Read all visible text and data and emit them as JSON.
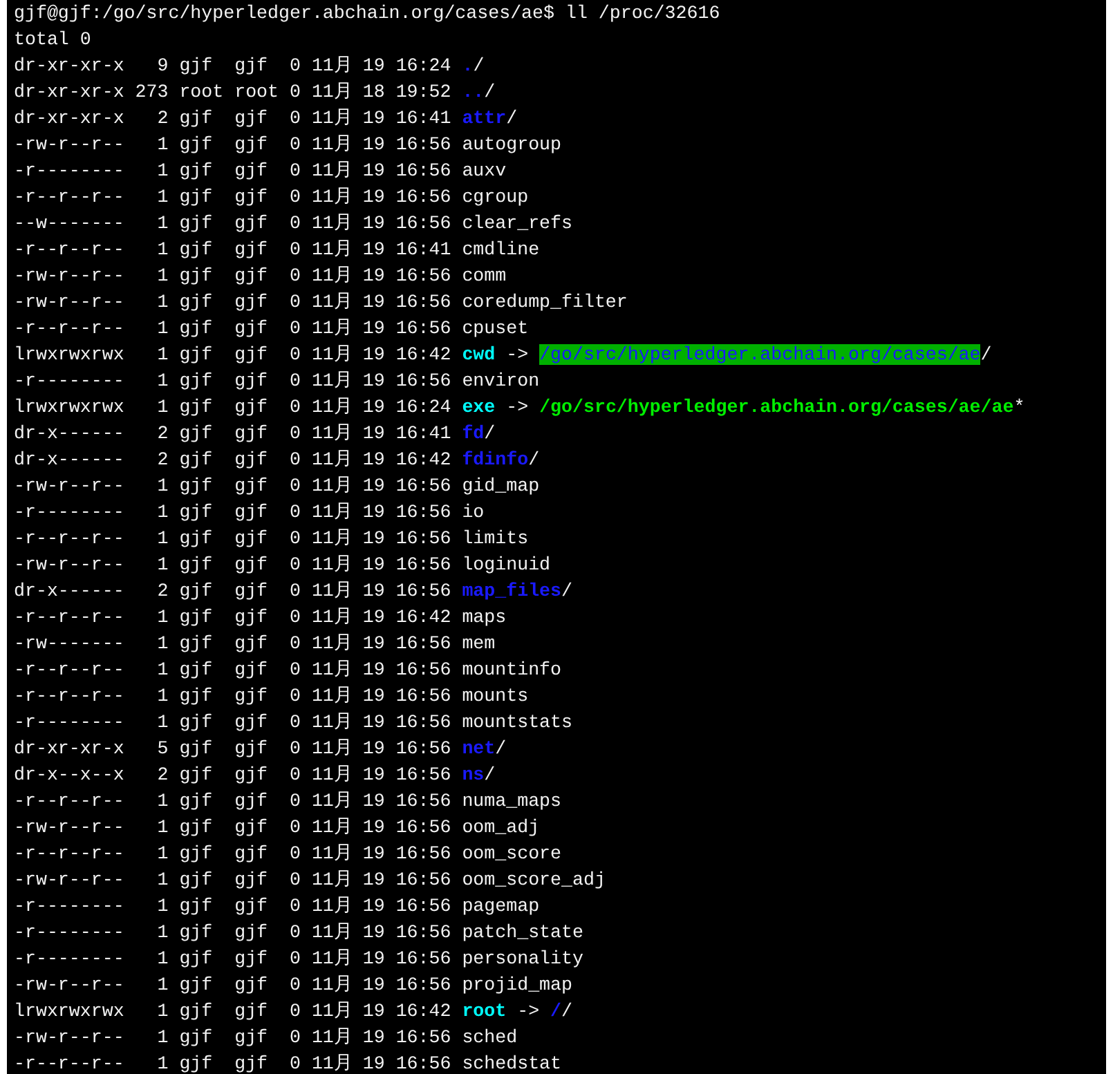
{
  "lines": [
    {
      "segments": [
        {
          "kind": "text",
          "text": "gjf@gjf:/go/src/hyperledger.abchain.org/cases/ae$ ll /proc/32616"
        }
      ]
    },
    {
      "segments": [
        {
          "kind": "text",
          "text": "total 0"
        }
      ]
    },
    {
      "segments": [
        {
          "kind": "text",
          "text": "dr-xr-xr-x   9 gjf  gjf  0 11月 19 16:24 "
        },
        {
          "kind": "dir",
          "text": "."
        },
        {
          "kind": "text",
          "text": "/"
        }
      ]
    },
    {
      "segments": [
        {
          "kind": "text",
          "text": "dr-xr-xr-x 273 root root 0 11月 18 19:52 "
        },
        {
          "kind": "dir",
          "text": ".."
        },
        {
          "kind": "text",
          "text": "/"
        }
      ]
    },
    {
      "segments": [
        {
          "kind": "text",
          "text": "dr-xr-xr-x   2 gjf  gjf  0 11月 19 16:41 "
        },
        {
          "kind": "dir",
          "text": "attr"
        },
        {
          "kind": "text",
          "text": "/"
        }
      ]
    },
    {
      "segments": [
        {
          "kind": "text",
          "text": "-rw-r--r--   1 gjf  gjf  0 11月 19 16:56 autogroup"
        }
      ]
    },
    {
      "segments": [
        {
          "kind": "text",
          "text": "-r--------   1 gjf  gjf  0 11月 19 16:56 auxv"
        }
      ]
    },
    {
      "segments": [
        {
          "kind": "text",
          "text": "-r--r--r--   1 gjf  gjf  0 11月 19 16:56 cgroup"
        }
      ]
    },
    {
      "segments": [
        {
          "kind": "text",
          "text": "--w-------   1 gjf  gjf  0 11月 19 16:56 clear_refs"
        }
      ]
    },
    {
      "segments": [
        {
          "kind": "text",
          "text": "-r--r--r--   1 gjf  gjf  0 11月 19 16:41 cmdline"
        }
      ]
    },
    {
      "segments": [
        {
          "kind": "text",
          "text": "-rw-r--r--   1 gjf  gjf  0 11月 19 16:56 comm"
        }
      ]
    },
    {
      "segments": [
        {
          "kind": "text",
          "text": "-rw-r--r--   1 gjf  gjf  0 11月 19 16:56 coredump_filter"
        }
      ]
    },
    {
      "segments": [
        {
          "kind": "text",
          "text": "-r--r--r--   1 gjf  gjf  0 11月 19 16:56 cpuset"
        }
      ]
    },
    {
      "segments": [
        {
          "kind": "text",
          "text": "lrwxrwxrwx   1 gjf  gjf  0 11月 19 16:42 "
        },
        {
          "kind": "link",
          "text": "cwd"
        },
        {
          "kind": "text",
          "text": " -> "
        },
        {
          "kind": "sticky",
          "text": "/go/src/hyperledger.abchain.org/cases/ae"
        },
        {
          "kind": "text",
          "text": "/"
        }
      ]
    },
    {
      "segments": [
        {
          "kind": "text",
          "text": "-r--------   1 gjf  gjf  0 11月 19 16:56 environ"
        }
      ]
    },
    {
      "segments": [
        {
          "kind": "text",
          "text": "lrwxrwxrwx   1 gjf  gjf  0 11月 19 16:24 "
        },
        {
          "kind": "link",
          "text": "exe"
        },
        {
          "kind": "text",
          "text": " -> "
        },
        {
          "kind": "exec",
          "text": "/go/src/hyperledger.abchain.org/cases/ae/ae"
        },
        {
          "kind": "text",
          "text": "*"
        }
      ]
    },
    {
      "segments": [
        {
          "kind": "text",
          "text": "dr-x------   2 gjf  gjf  0 11月 19 16:41 "
        },
        {
          "kind": "dir",
          "text": "fd"
        },
        {
          "kind": "text",
          "text": "/"
        }
      ]
    },
    {
      "segments": [
        {
          "kind": "text",
          "text": "dr-x------   2 gjf  gjf  0 11月 19 16:42 "
        },
        {
          "kind": "dir",
          "text": "fdinfo"
        },
        {
          "kind": "text",
          "text": "/"
        }
      ]
    },
    {
      "segments": [
        {
          "kind": "text",
          "text": "-rw-r--r--   1 gjf  gjf  0 11月 19 16:56 gid_map"
        }
      ]
    },
    {
      "segments": [
        {
          "kind": "text",
          "text": "-r--------   1 gjf  gjf  0 11月 19 16:56 io"
        }
      ]
    },
    {
      "segments": [
        {
          "kind": "text",
          "text": "-r--r--r--   1 gjf  gjf  0 11月 19 16:56 limits"
        }
      ]
    },
    {
      "segments": [
        {
          "kind": "text",
          "text": "-rw-r--r--   1 gjf  gjf  0 11月 19 16:56 loginuid"
        }
      ]
    },
    {
      "segments": [
        {
          "kind": "text",
          "text": "dr-x------   2 gjf  gjf  0 11月 19 16:56 "
        },
        {
          "kind": "dir",
          "text": "map_files"
        },
        {
          "kind": "text",
          "text": "/"
        }
      ]
    },
    {
      "segments": [
        {
          "kind": "text",
          "text": "-r--r--r--   1 gjf  gjf  0 11月 19 16:42 maps"
        }
      ]
    },
    {
      "segments": [
        {
          "kind": "text",
          "text": "-rw-------   1 gjf  gjf  0 11月 19 16:56 mem"
        }
      ]
    },
    {
      "segments": [
        {
          "kind": "text",
          "text": "-r--r--r--   1 gjf  gjf  0 11月 19 16:56 mountinfo"
        }
      ]
    },
    {
      "segments": [
        {
          "kind": "text",
          "text": "-r--r--r--   1 gjf  gjf  0 11月 19 16:56 mounts"
        }
      ]
    },
    {
      "segments": [
        {
          "kind": "text",
          "text": "-r--------   1 gjf  gjf  0 11月 19 16:56 mountstats"
        }
      ]
    },
    {
      "segments": [
        {
          "kind": "text",
          "text": "dr-xr-xr-x   5 gjf  gjf  0 11月 19 16:56 "
        },
        {
          "kind": "dir",
          "text": "net"
        },
        {
          "kind": "text",
          "text": "/"
        }
      ]
    },
    {
      "segments": [
        {
          "kind": "text",
          "text": "dr-x--x--x   2 gjf  gjf  0 11月 19 16:56 "
        },
        {
          "kind": "dir",
          "text": "ns"
        },
        {
          "kind": "text",
          "text": "/"
        }
      ]
    },
    {
      "segments": [
        {
          "kind": "text",
          "text": "-r--r--r--   1 gjf  gjf  0 11月 19 16:56 numa_maps"
        }
      ]
    },
    {
      "segments": [
        {
          "kind": "text",
          "text": "-rw-r--r--   1 gjf  gjf  0 11月 19 16:56 oom_adj"
        }
      ]
    },
    {
      "segments": [
        {
          "kind": "text",
          "text": "-r--r--r--   1 gjf  gjf  0 11月 19 16:56 oom_score"
        }
      ]
    },
    {
      "segments": [
        {
          "kind": "text",
          "text": "-rw-r--r--   1 gjf  gjf  0 11月 19 16:56 oom_score_adj"
        }
      ]
    },
    {
      "segments": [
        {
          "kind": "text",
          "text": "-r--------   1 gjf  gjf  0 11月 19 16:56 pagemap"
        }
      ]
    },
    {
      "segments": [
        {
          "kind": "text",
          "text": "-r--------   1 gjf  gjf  0 11月 19 16:56 patch_state"
        }
      ]
    },
    {
      "segments": [
        {
          "kind": "text",
          "text": "-r--------   1 gjf  gjf  0 11月 19 16:56 personality"
        }
      ]
    },
    {
      "segments": [
        {
          "kind": "text",
          "text": "-rw-r--r--   1 gjf  gjf  0 11月 19 16:56 projid_map"
        }
      ]
    },
    {
      "segments": [
        {
          "kind": "text",
          "text": "lrwxrwxrwx   1 gjf  gjf  0 11月 19 16:42 "
        },
        {
          "kind": "link",
          "text": "root"
        },
        {
          "kind": "text",
          "text": " -> "
        },
        {
          "kind": "dir",
          "text": "/"
        },
        {
          "kind": "text",
          "text": "/"
        }
      ]
    },
    {
      "segments": [
        {
          "kind": "text",
          "text": "-rw-r--r--   1 gjf  gjf  0 11月 19 16:56 sched"
        }
      ]
    },
    {
      "segments": [
        {
          "kind": "text",
          "text": "-r--r--r--   1 gjf  gjf  0 11月 19 16:56 schedstat"
        }
      ]
    }
  ]
}
